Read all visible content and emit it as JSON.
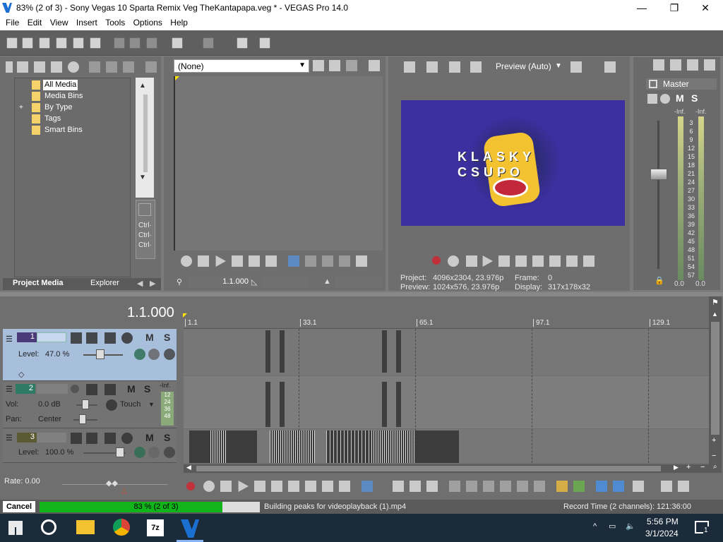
{
  "window": {
    "title": "83% (2 of 3) - Sony Vegas 10 Sparta Remix Veg TheKantapapa.veg * - VEGAS Pro 14.0",
    "min": "—",
    "max": "❐",
    "close": "✕"
  },
  "menu": [
    "File",
    "Edit",
    "View",
    "Insert",
    "Tools",
    "Options",
    "Help"
  ],
  "project_media": {
    "tree": [
      "All Media",
      "Media Bins",
      "By Type",
      "Tags",
      "Smart Bins"
    ],
    "expand_glyph": "+",
    "tabs": [
      "Project Media",
      "Explorer"
    ],
    "shortcuts": [
      "Ctrl·",
      "Ctrl·",
      "Ctrl·"
    ]
  },
  "trimmer": {
    "dropdown_value": "(None)",
    "time": "1.1.000"
  },
  "preview": {
    "mode": "Preview (Auto)",
    "project_label": "Project:",
    "project_value": "4096x2304, 23.976p",
    "preview_label": "Preview:",
    "preview_value": "1024x576, 23.976p",
    "frame_label": "Frame:",
    "frame_value": "0",
    "display_label": "Display:",
    "display_value": "317x178x32",
    "klasky_top": "KLASKY",
    "klasky_bottom": "CSUPO"
  },
  "mixer": {
    "title": "Master",
    "m": "M",
    "s": "S",
    "inf_left": "-Inf.",
    "inf_right": "-Inf.",
    "scale": [
      "3",
      "6",
      "9",
      "12",
      "15",
      "18",
      "21",
      "24",
      "27",
      "30",
      "33",
      "36",
      "39",
      "42",
      "45",
      "48",
      "51",
      "54",
      "57"
    ],
    "bottom_left": "0.0",
    "bottom_right": "0.0"
  },
  "timeline": {
    "time": "1.1.000",
    "ruler": [
      "1.1",
      "33.1",
      "65.1",
      "97.1",
      "129.1"
    ],
    "rate": "Rate: 0.00",
    "tracks": [
      {
        "num": "1",
        "level_label": "Level:",
        "level_value": "47.0 %",
        "level_pct": 47,
        "m": "M",
        "s": "S"
      },
      {
        "num": "2",
        "vol_label": "Vol:",
        "vol_value": "0.0 dB",
        "pan_label": "Pan:",
        "pan_value": "Center",
        "automation": "Touch",
        "m": "M",
        "s": "S",
        "meter_inf": "-Inf.",
        "meter_scale": [
          "12",
          "24",
          "36",
          "48"
        ]
      },
      {
        "num": "3",
        "level_label": "Level:",
        "level_value": "100.0 %",
        "level_pct": 100,
        "m": "M",
        "s": "S"
      }
    ]
  },
  "status": {
    "cancel": "Cancel",
    "progress_text": "83 % (2 of 3)",
    "progress_pct": 83,
    "message": "Building peaks for videoplayback (1).mp4",
    "record_time": "Record Time (2 channels): 121:36:00"
  },
  "taskbar": {
    "time": "5:56 PM",
    "date": "3/1/2024",
    "notification_count": "1",
    "apps": [
      "start-icon",
      "search-icon",
      "file-explorer-icon",
      "chrome-icon",
      "7zip-icon",
      "vegas-icon"
    ]
  }
}
